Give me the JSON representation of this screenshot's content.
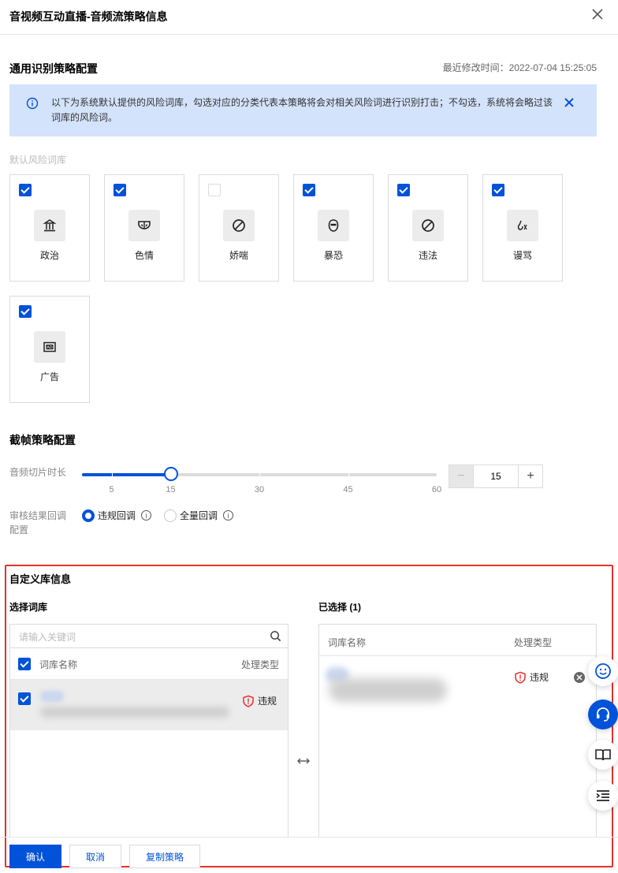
{
  "dialog": {
    "title": "音视频互动直播-音频流策略信息"
  },
  "general": {
    "title": "通用识别策略配置",
    "modified_label": "最近修改时间：2022-07-04 15:25:05",
    "alert_text": "以下为系统默认提供的风险词库，勾选对应的分类代表本策略将会对相关风险词进行识别打击；不勾选，系统将会略过该词库的风险词。",
    "default_lib_label": "默认风险词库",
    "categories": [
      {
        "label": "政治",
        "checked": true,
        "icon": "government-building-icon"
      },
      {
        "label": "色情",
        "checked": true,
        "icon": "lingerie-icon"
      },
      {
        "label": "娇喘",
        "checked": false,
        "icon": "prohibited-icon"
      },
      {
        "label": "暴恐",
        "checked": true,
        "icon": "terror-mask-icon"
      },
      {
        "label": "违法",
        "checked": true,
        "icon": "prohibited-icon"
      },
      {
        "label": "谩骂",
        "checked": true,
        "icon": "cursing-icon"
      },
      {
        "label": "广告",
        "checked": true,
        "icon": "ad-icon"
      }
    ]
  },
  "frame": {
    "title": "截帧策略配置",
    "slice_label": "音频切片时长",
    "slider": {
      "min": 0,
      "max": 60,
      "value": 15,
      "ticks": [
        "5",
        "15",
        "30",
        "45",
        "60"
      ]
    },
    "stepper": {
      "minus": "−",
      "value": "15",
      "plus": "+"
    },
    "callback_label": "审核结果回调配置",
    "callback_options": [
      {
        "label": "违规回调",
        "selected": true
      },
      {
        "label": "全量回调",
        "selected": false
      }
    ]
  },
  "custom": {
    "title": "自定义库信息",
    "left": {
      "title": "选择词库",
      "search_placeholder": "请输入关键词",
      "col_name": "词库名称",
      "col_type": "处理类型",
      "row_type": "违规"
    },
    "right": {
      "title": "已选择 (1)",
      "col_name": "词库名称",
      "col_type": "处理类型",
      "row_type": "违规"
    }
  },
  "footer": {
    "confirm": "确认",
    "cancel": "取消",
    "copy": "复制策略"
  },
  "colors": {
    "primary": "#0052d9",
    "alert_bg": "#d4e3fc",
    "danger": "#e5322d"
  }
}
